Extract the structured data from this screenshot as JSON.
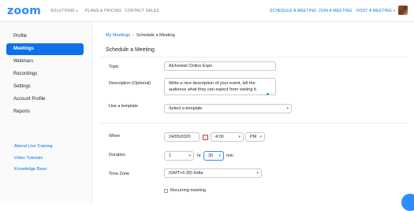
{
  "header": {
    "logo": "zoom",
    "nav_left": [
      "SOLUTIONS",
      "PLANS & PRICING",
      "CONTACT SALES"
    ],
    "nav_right": [
      "SCHEDULE A MEETING",
      "JOIN A MEETING",
      "HOST A MEETING"
    ],
    "caret": "▾",
    "brand_color": "#2d8cff"
  },
  "sidebar": {
    "items": [
      "Profile",
      "Meetings",
      "Webinars",
      "Recordings",
      "Settings",
      "Account Profile",
      "Reports"
    ],
    "active": "Meetings",
    "links": [
      "Attend Live Training",
      "Video Tutorials",
      "Knowledge Base"
    ]
  },
  "main": {
    "breadcrumb_parent": "My Meetings",
    "breadcrumb_sep": "›",
    "breadcrumb_current": "Schedule a Meeting",
    "title": "Schedule a Meeting",
    "topic_label": "Topic",
    "topic_value": "Alchemist Online Expo",
    "description_label": "Description (Optional)",
    "description_value": "Write a nice description of your event, tell the audience what they can expect from visiting it.",
    "template_label": "Use a template",
    "template_value": "Select a template",
    "when_label": "When",
    "date_value": "24/05/2020",
    "time_value": "4:00",
    "ampm_value": "PM",
    "duration_label": "Duration",
    "duration_hours": "1",
    "hours_unit": "hr",
    "duration_minutes": "30",
    "minutes_unit": "min",
    "timezone_label": "Time Zone",
    "timezone_value": "(GMT+5:30) India",
    "recurring_label": "Recurring meeting",
    "dropdown_arrow": "▾"
  }
}
